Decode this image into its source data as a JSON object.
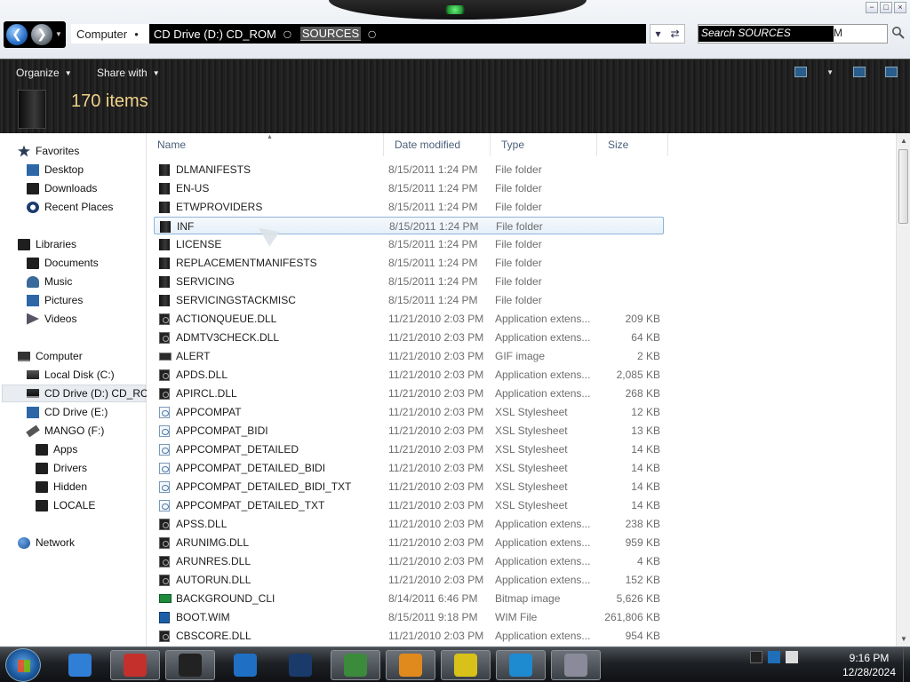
{
  "window": {
    "controls": [
      "−",
      "□",
      "×"
    ]
  },
  "address": {
    "crumbs": [
      {
        "label": "Computer"
      },
      {
        "label": "CD Drive (D:) CD_ROM"
      },
      {
        "label": "SOURCES"
      }
    ],
    "search_placeholder": "Search SOURCES",
    "search_overflow": "M"
  },
  "toolbar": {
    "organize_label": "Organize",
    "share_label": "Share with",
    "item_count": "170 items"
  },
  "nav": {
    "favorites": "Favorites",
    "desktop": "Desktop",
    "downloads": "Downloads",
    "recent": "Recent Places",
    "libraries": "Libraries",
    "documents": "Documents",
    "music": "Music",
    "pictures": "Pictures",
    "videos": "Videos",
    "computer": "Computer",
    "local_disk": "Local Disk (C:)",
    "cd_d": "CD Drive (D:) CD_RC",
    "cd_e": "CD Drive (E:)",
    "mango": "MANGO (F:)",
    "apps": "Apps",
    "drivers": "Drivers",
    "hidden": "Hidden",
    "locale": "LOCALE",
    "network": "Network"
  },
  "columns": {
    "name": "Name",
    "date": "Date modified",
    "type": "Type",
    "size": "Size"
  },
  "files": [
    {
      "name": "DLMANIFESTS",
      "date": "8/15/2011 1:24 PM",
      "type": "File folder",
      "size": "",
      "icon": "folder"
    },
    {
      "name": "EN-US",
      "date": "8/15/2011 1:24 PM",
      "type": "File folder",
      "size": "",
      "icon": "folder"
    },
    {
      "name": "ETWPROVIDERS",
      "date": "8/15/2011 1:24 PM",
      "type": "File folder",
      "size": "",
      "icon": "folder"
    },
    {
      "name": "INF",
      "date": "8/15/2011 1:24 PM",
      "type": "File folder",
      "size": "",
      "icon": "folder",
      "selected": true
    },
    {
      "name": "LICENSE",
      "date": "8/15/2011 1:24 PM",
      "type": "File folder",
      "size": "",
      "icon": "folder"
    },
    {
      "name": "REPLACEMENTMANIFESTS",
      "date": "8/15/2011 1:24 PM",
      "type": "File folder",
      "size": "",
      "icon": "folder"
    },
    {
      "name": "SERVICING",
      "date": "8/15/2011 1:24 PM",
      "type": "File folder",
      "size": "",
      "icon": "folder"
    },
    {
      "name": "SERVICINGSTACKMISC",
      "date": "8/15/2011 1:24 PM",
      "type": "File folder",
      "size": "",
      "icon": "folder"
    },
    {
      "name": "ACTIONQUEUE.DLL",
      "date": "11/21/2010 2:03 PM",
      "type": "Application extens...",
      "size": "209 KB",
      "icon": "dll"
    },
    {
      "name": "ADMTV3CHECK.DLL",
      "date": "11/21/2010 2:03 PM",
      "type": "Application extens...",
      "size": "64 KB",
      "icon": "dll"
    },
    {
      "name": "ALERT",
      "date": "11/21/2010 2:03 PM",
      "type": "GIF image",
      "size": "2 KB",
      "icon": "gif"
    },
    {
      "name": "APDS.DLL",
      "date": "11/21/2010 2:03 PM",
      "type": "Application extens...",
      "size": "2,085 KB",
      "icon": "dll"
    },
    {
      "name": "APIRCL.DLL",
      "date": "11/21/2010 2:03 PM",
      "type": "Application extens...",
      "size": "268 KB",
      "icon": "dll"
    },
    {
      "name": "APPCOMPAT",
      "date": "11/21/2010 2:03 PM",
      "type": "XSL Stylesheet",
      "size": "12 KB",
      "icon": "xsl"
    },
    {
      "name": "APPCOMPAT_BIDI",
      "date": "11/21/2010 2:03 PM",
      "type": "XSL Stylesheet",
      "size": "13 KB",
      "icon": "xsl"
    },
    {
      "name": "APPCOMPAT_DETAILED",
      "date": "11/21/2010 2:03 PM",
      "type": "XSL Stylesheet",
      "size": "14 KB",
      "icon": "xsl"
    },
    {
      "name": "APPCOMPAT_DETAILED_BIDI",
      "date": "11/21/2010 2:03 PM",
      "type": "XSL Stylesheet",
      "size": "14 KB",
      "icon": "xsl"
    },
    {
      "name": "APPCOMPAT_DETAILED_BIDI_TXT",
      "date": "11/21/2010 2:03 PM",
      "type": "XSL Stylesheet",
      "size": "14 KB",
      "icon": "xsl"
    },
    {
      "name": "APPCOMPAT_DETAILED_TXT",
      "date": "11/21/2010 2:03 PM",
      "type": "XSL Stylesheet",
      "size": "14 KB",
      "icon": "xsl"
    },
    {
      "name": "APSS.DLL",
      "date": "11/21/2010 2:03 PM",
      "type": "Application extens...",
      "size": "238 KB",
      "icon": "dll"
    },
    {
      "name": "ARUNIMG.DLL",
      "date": "11/21/2010 2:03 PM",
      "type": "Application extens...",
      "size": "959 KB",
      "icon": "dll"
    },
    {
      "name": "ARUNRES.DLL",
      "date": "11/21/2010 2:03 PM",
      "type": "Application extens...",
      "size": "4 KB",
      "icon": "dll"
    },
    {
      "name": "AUTORUN.DLL",
      "date": "11/21/2010 2:03 PM",
      "type": "Application extens...",
      "size": "152 KB",
      "icon": "dll"
    },
    {
      "name": "BACKGROUND_CLI",
      "date": "8/14/2011 6:46 PM",
      "type": "Bitmap image",
      "size": "5,626 KB",
      "icon": "bmp"
    },
    {
      "name": "BOOT.WIM",
      "date": "8/15/2011 9:18 PM",
      "type": "WIM File",
      "size": "261,806 KB",
      "icon": "wim"
    },
    {
      "name": "CBSCORE.DLL",
      "date": "11/21/2010 2:03 PM",
      "type": "Application extens...",
      "size": "954 KB",
      "icon": "dll"
    }
  ],
  "taskbar": {
    "apps": [
      {
        "name": "internet-explorer",
        "color": "#2f7fd6"
      },
      {
        "name": "red-cube-app",
        "color": "#c4302b",
        "active": true
      },
      {
        "name": "black-box-app",
        "color": "#222222",
        "active": true
      },
      {
        "name": "media-player",
        "color": "#1f6fc4"
      },
      {
        "name": "globe-app",
        "color": "#1a3a6a"
      },
      {
        "name": "network-app",
        "color": "#3c8a3c",
        "active": true
      },
      {
        "name": "magnifier-app",
        "color": "#e08a1e",
        "active": true
      },
      {
        "name": "checklist-app",
        "color": "#d8c21a",
        "active": true
      },
      {
        "name": "f-app",
        "color": "#1e8ad0",
        "active": true
      },
      {
        "name": "disc-app",
        "color": "#8a8a9a",
        "active": true
      }
    ],
    "time": "9:16 PM",
    "date": "12/28/2024"
  }
}
